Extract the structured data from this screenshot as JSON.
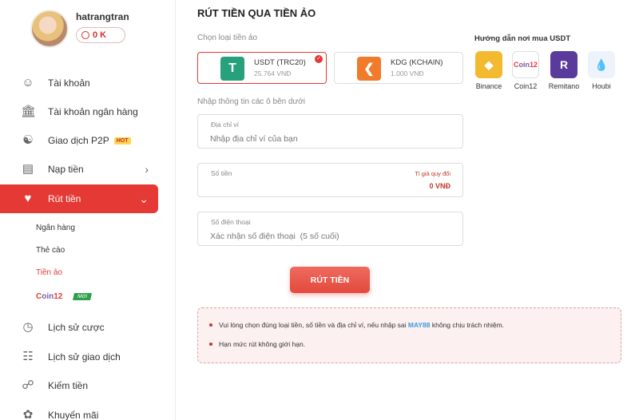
{
  "user": {
    "name": "hatrangtran",
    "balance": "0 K"
  },
  "sidebar": {
    "items": [
      {
        "label": "Tài khoản",
        "icon": "user-icon"
      },
      {
        "label": "Tài khoản ngân hàng",
        "icon": "bank-icon"
      },
      {
        "label": "Giao dịch P2P",
        "icon": "p2p-icon",
        "badge": "HOT"
      },
      {
        "label": "Nạp tiền",
        "icon": "deposit-icon"
      },
      {
        "label": "Rút tiền",
        "icon": "piggy-bank-icon"
      },
      {
        "label": "Lịch sử cược",
        "icon": "bet-history-icon"
      },
      {
        "label": "Lịch sử giao dịch",
        "icon": "transaction-history-icon"
      },
      {
        "label": "Kiếm tiền",
        "icon": "earn-icon"
      },
      {
        "label": "Khuyến mãi",
        "icon": "promotion-icon"
      }
    ],
    "subitems": [
      "Ngân hàng",
      "Thẻ cào",
      "Tiền ảo"
    ],
    "coin12_badge": "Mới"
  },
  "main": {
    "title": "RÚT TIỀN QUA TIỀN ẢO",
    "choose_label": "Chọn loại tiền ảo",
    "coins": [
      {
        "name": "USDT (TRC20)",
        "rate": "25.764 VNĐ",
        "selected": true,
        "color": "#26a17b"
      },
      {
        "name": "KDG (KCHAIN)",
        "rate": "1.000 VNĐ",
        "selected": false,
        "color": "#f07b2b"
      }
    ],
    "guide_title": "Hướng dẫn nơi mua USDT",
    "exchanges": [
      {
        "name": "Binance",
        "color": "#f3ba2f"
      },
      {
        "name": "Coin12",
        "color": "#7b5ea7"
      },
      {
        "name": "Remitano",
        "color": "#5a3a9a"
      },
      {
        "name": "Houbi",
        "color": "#1e6fd9"
      }
    ],
    "form_label": "Nhập thông tin các ô bên dưới",
    "wallet": {
      "label": "Địa chỉ ví",
      "placeholder": "Nhập địa chỉ ví của bạn"
    },
    "amount": {
      "label": "Số tiền",
      "rate_label": "Tỉ giá quy đổi",
      "converted": "0 VNĐ"
    },
    "phone": {
      "label": "Số điện thoại",
      "placeholder": "Xác nhận số điện thoại  (5 số cuối)"
    },
    "submit_label": "RÚT TIỀN",
    "notice": {
      "line1_pre": "Vui lòng chọn đúng loại tiền, số tiền và địa chỉ ví, nếu nhập sai ",
      "line1_brand": "MAY88",
      "line1_post": " không chịu trách nhiệm.",
      "line2": "Hạn mức rút không giới hạn."
    },
    "accent_color": "#e53935"
  }
}
